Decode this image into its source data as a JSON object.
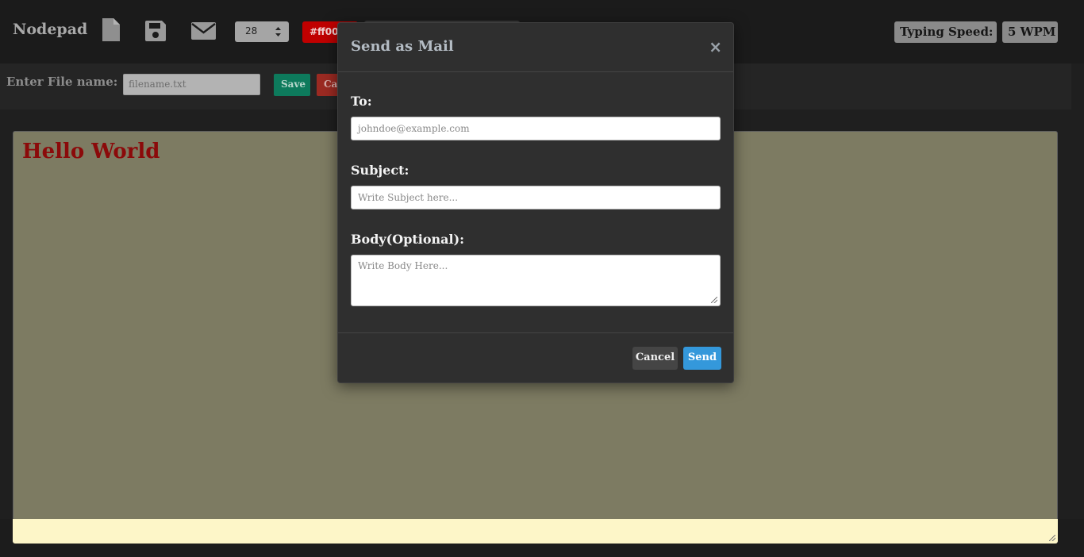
{
  "navbar": {
    "brand": "Nodepad",
    "icons": [
      "new-file-icon",
      "save-icon",
      "mail-icon"
    ],
    "font_size": "28",
    "color_value": "#ff00",
    "typing_speed_label": "Typing Speed:",
    "typing_speed_value": "5 WPM"
  },
  "filebar": {
    "label": "Enter File name:",
    "input_placeholder": "filename.txt",
    "save_label": "Save",
    "cancel_label": "Ca"
  },
  "editor": {
    "text": "Hello World",
    "background": "#7d7b62",
    "text_color": "#8b0a0a"
  },
  "modal": {
    "title": "Send as Mail",
    "close_glyph": "×",
    "to_label": "To:",
    "to_placeholder": "johndoe@example.com",
    "subject_label": "Subject:",
    "subject_placeholder": "Write Subject here...",
    "body_label": "Body(Optional):",
    "body_placeholder": "Write Body Here...",
    "cancel_label": "Cancel",
    "send_label": "Send",
    "send_color": "#3498db"
  }
}
